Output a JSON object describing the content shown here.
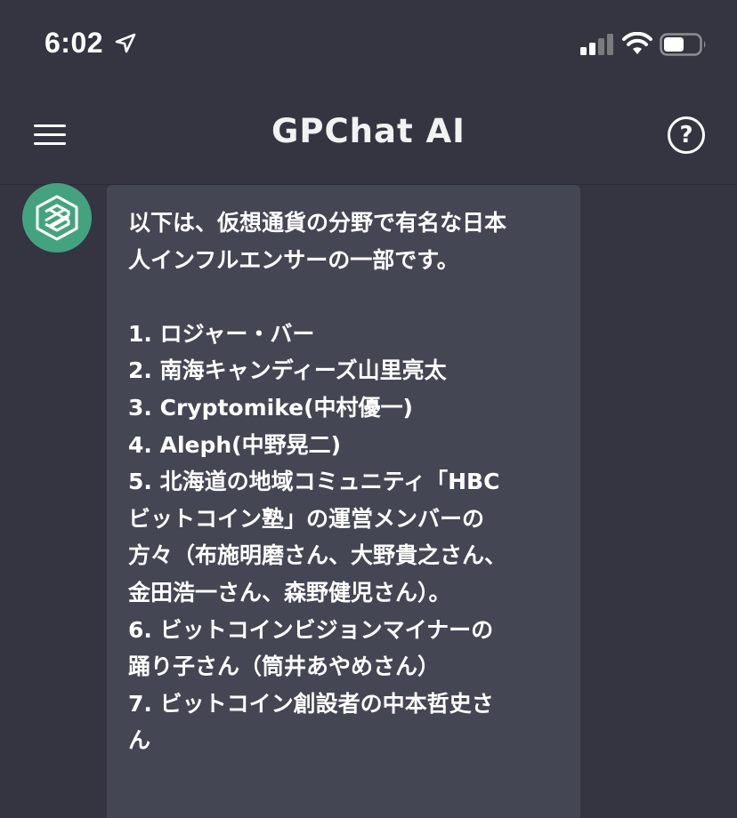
{
  "status_bar": {
    "time": "6:02",
    "icons": [
      "location-arrow-icon",
      "cellular-signal-icon",
      "wifi-icon",
      "battery-icon"
    ]
  },
  "header": {
    "title": "GPChat AI",
    "menu_icon": "hamburger-menu-icon",
    "help_icon": "help-circle-icon",
    "help_glyph": "?"
  },
  "chat": {
    "avatar_icon": "chatbot-logo-icon",
    "message_lines": [
      "以下は、仮想通貨の分野で有名な日本",
      "人インフルエンサーの一部です。",
      "",
      "1. ロジャー・バー",
      "2. 南海キャンディーズ山里亮太",
      "3. Cryptomike(中村優一)",
      "4. Aleph(中野晃二)",
      "5. 北海道の地域コミュニティ「HBC",
      "ビットコイン塾」の運営メンバーの",
      "方々（布施明磨さん、大野貴之さん、",
      "金田浩一さん、森野健児さん）。",
      "6. ビットコインビジョンマイナーの",
      "踊り子さん（筒井あやめさん）",
      "7. ビットコイン創設者の中本哲史さ",
      "ん"
    ]
  },
  "colors": {
    "background": "#343541",
    "bubble": "#444654",
    "avatar": "#44a37f",
    "text": "#ffffff"
  }
}
